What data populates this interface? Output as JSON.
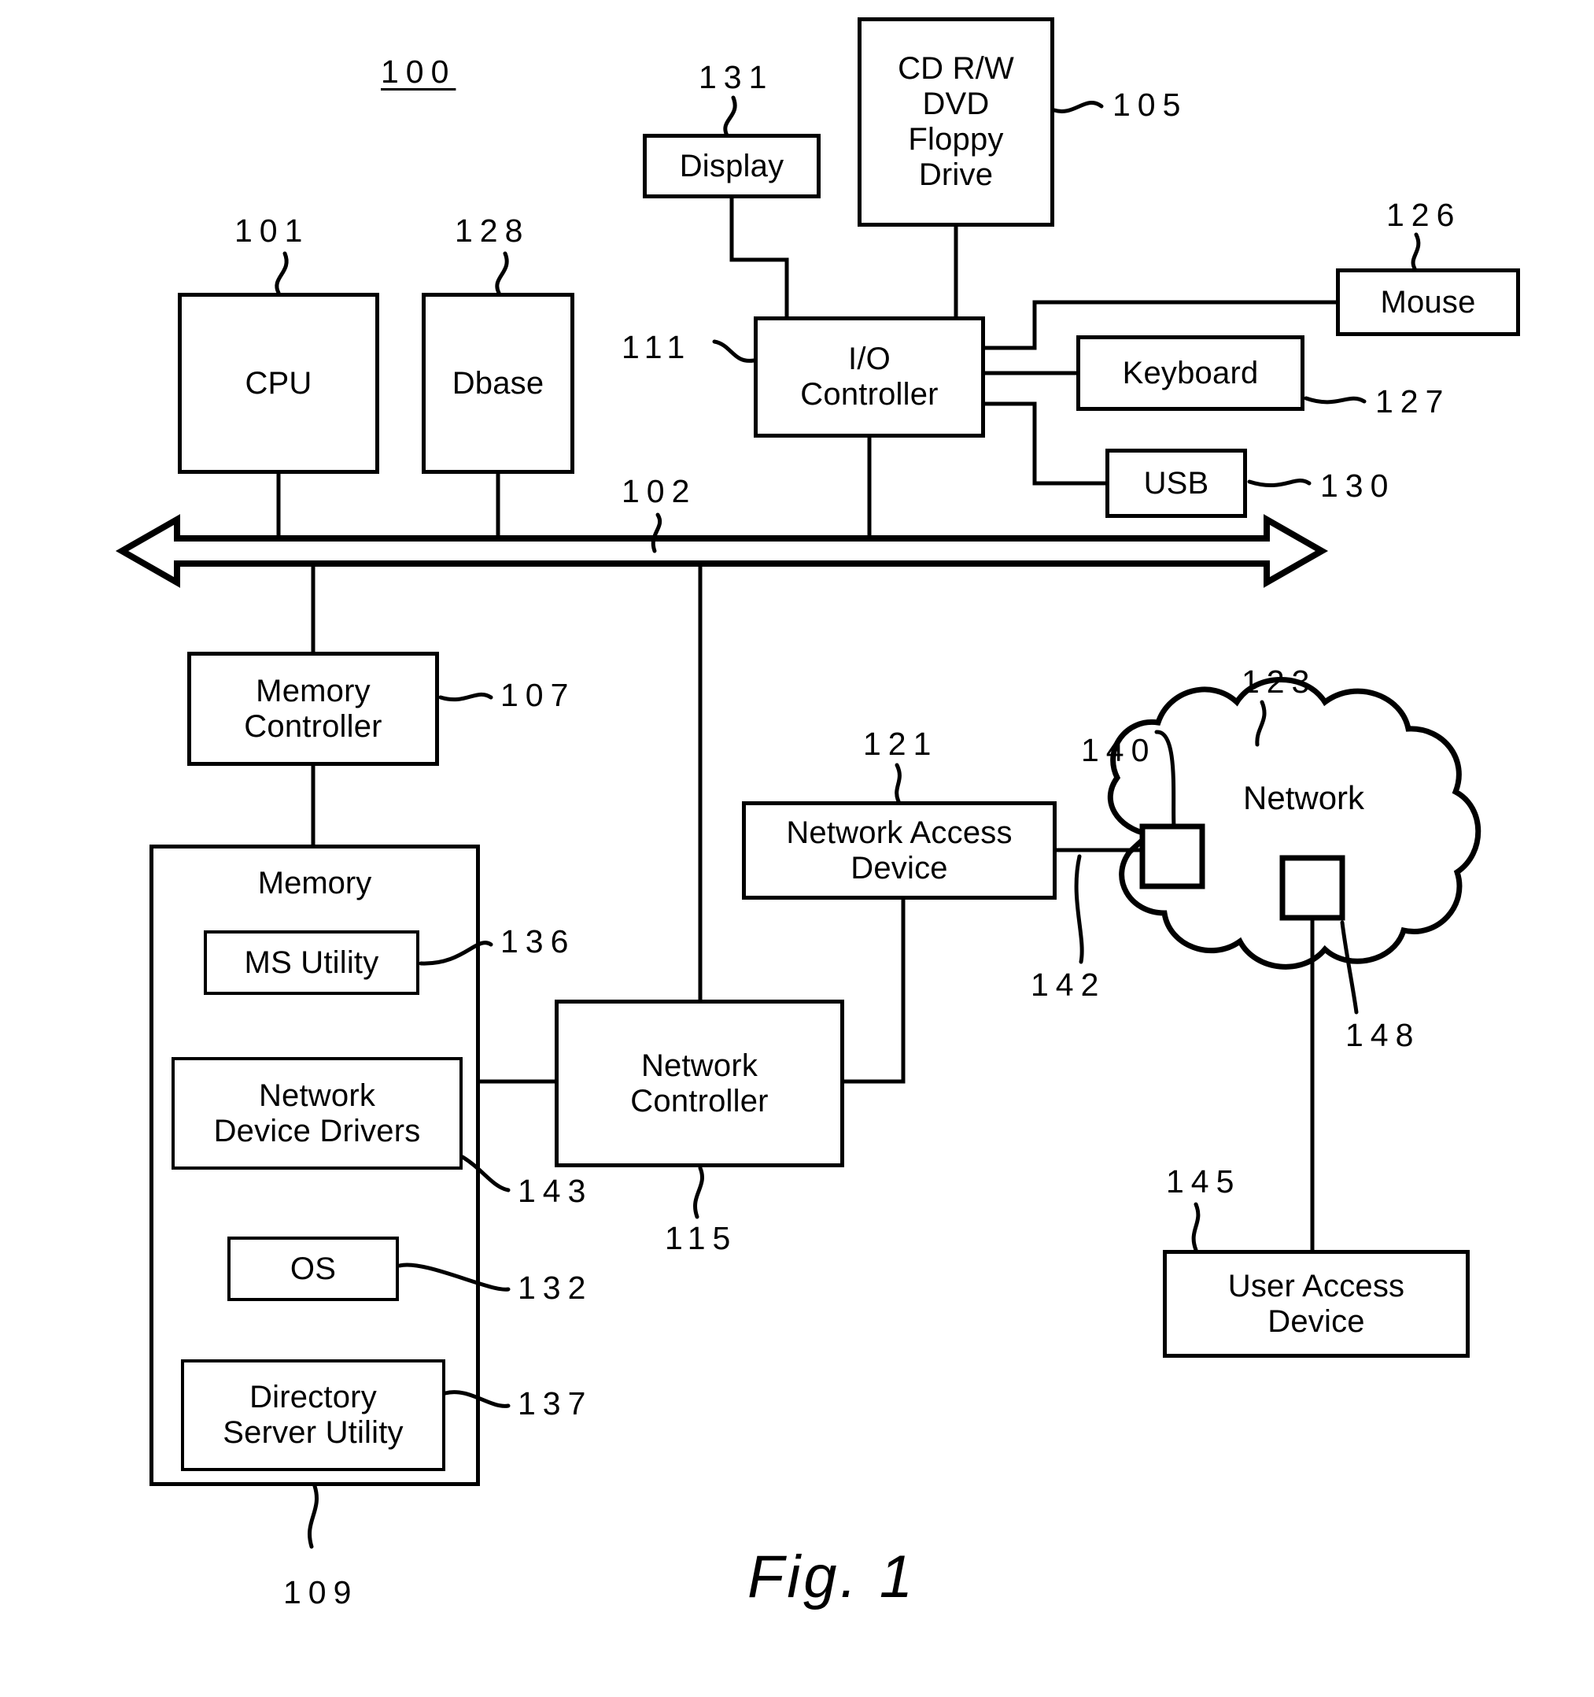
{
  "figure": {
    "caption": "Fig.  1",
    "system_ref": "100"
  },
  "nodes": {
    "cpu": {
      "label": "CPU",
      "ref": "101"
    },
    "dbase": {
      "label": "Dbase",
      "ref": "128"
    },
    "display": {
      "label": "Display",
      "ref": "131"
    },
    "optical_drive": {
      "label": "CD R/W\nDVD\nFloppy\nDrive",
      "ref": "105"
    },
    "io_controller": {
      "label": "I/O\nController",
      "ref": "111"
    },
    "mouse": {
      "label": "Mouse",
      "ref": "126"
    },
    "keyboard": {
      "label": "Keyboard",
      "ref": "127"
    },
    "usb": {
      "label": "USB",
      "ref": "130"
    },
    "bus": {
      "ref": "102"
    },
    "memory_controller": {
      "label": "Memory\nController",
      "ref": "107"
    },
    "memory": {
      "label": "Memory",
      "ref": "109"
    },
    "ms_utility": {
      "label": "MS Utility",
      "ref": "136"
    },
    "network_device_drivers": {
      "label": "Network\nDevice Drivers",
      "ref": "143"
    },
    "os": {
      "label": "OS",
      "ref": "132"
    },
    "directory_server_utility": {
      "label": "Directory\nServer Utility",
      "ref": "137"
    },
    "network_controller": {
      "label": "Network\nController",
      "ref": "115"
    },
    "network_access_device": {
      "label": "Network Access\nDevice",
      "ref": "121"
    },
    "network_cloud": {
      "label": "Network",
      "ref": "123"
    },
    "cloud_node_left": {
      "label": "",
      "ref": "140"
    },
    "cloud_link_left": {
      "ref": "142"
    },
    "cloud_node_right": {
      "label": "",
      "ref": "148"
    },
    "user_access_device": {
      "label": "User Access\nDevice",
      "ref": "145"
    }
  }
}
